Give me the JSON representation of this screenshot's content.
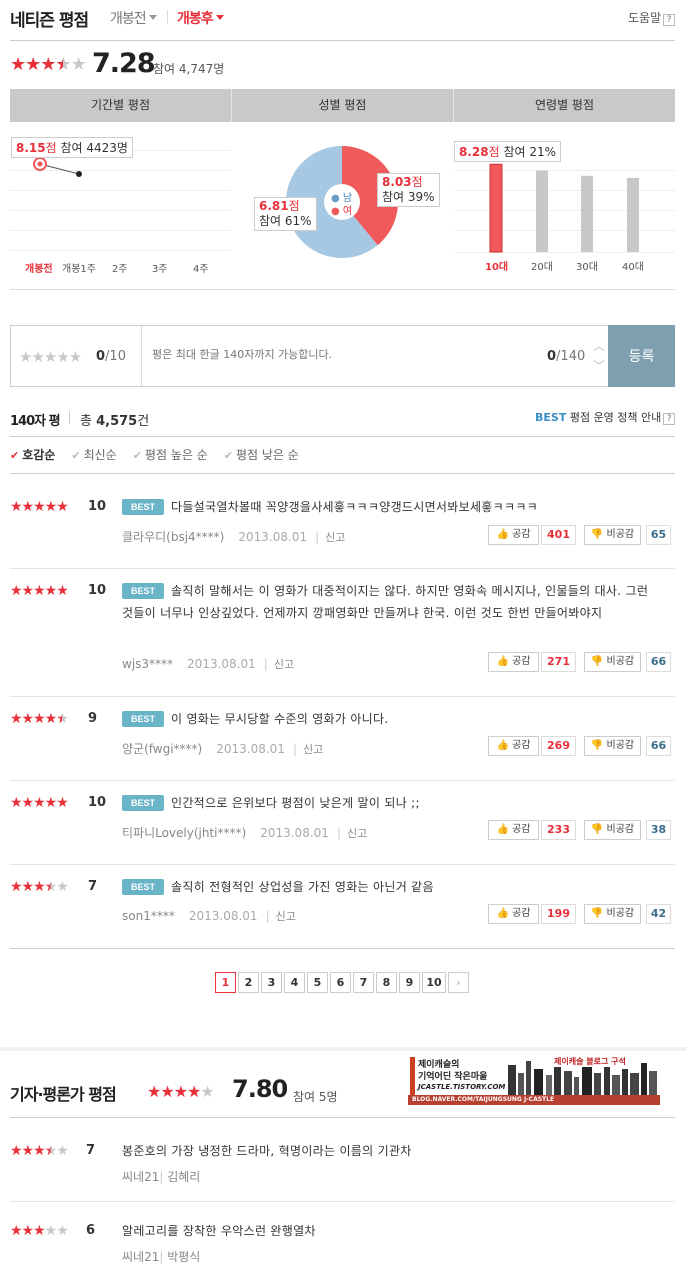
{
  "header": {
    "title": "네티즌 평점",
    "tab_before": "개봉전",
    "tab_after": "개봉후",
    "help": "도움말",
    "help_icon": "?"
  },
  "overall": {
    "score": "7.28",
    "count": "참여 4,747명",
    "stars_filled": 3.5
  },
  "chart_header": [
    "기간별 평점",
    "성별 평점",
    "연령별 평점"
  ],
  "chart_data": [
    {
      "type": "line",
      "categories": [
        "개봉전",
        "개봉1주",
        "2주",
        "3주",
        "4주"
      ],
      "values": [
        8.15,
        7.9,
        null,
        null,
        null
      ],
      "annotation": {
        "score": "8.15",
        "unit": "점",
        "count": "참여 4423명"
      }
    },
    {
      "type": "pie",
      "slices": [
        {
          "name": "남",
          "value": 61,
          "score": "6.81",
          "count": "참여 61%",
          "color": "#a6c8e2"
        },
        {
          "name": "여",
          "value": 39,
          "score": "8.03",
          "count": "참여 39%",
          "color": "#f05a5a"
        }
      ],
      "unit": "점"
    },
    {
      "type": "bar",
      "categories": [
        "10대",
        "20대",
        "30대",
        "40대"
      ],
      "values": [
        8.28,
        7.7,
        7.2,
        7.0
      ],
      "highlight": "10대",
      "annotation": {
        "score": "8.28",
        "unit": "점",
        "count": "참여 21%"
      },
      "colors": {
        "highlight": "#f05a5a",
        "normal": "#c8c8c8"
      }
    }
  ],
  "write": {
    "max_label_bold": "0",
    "max_label": "/10",
    "placeholder": "평은 최대 한글 140자까지 가능합니다.",
    "counter_bold": "0",
    "counter": "/140",
    "submit": "등록"
  },
  "reviews_header": {
    "title": "140자 평",
    "total_prefix": "총",
    "total": "4,575",
    "total_suffix": "건",
    "best_label": "BEST",
    "policy": "평점 운영 정책 안내"
  },
  "sorts": [
    "호감순",
    "최신순",
    "평점 높은 순",
    "평점 낮은 순"
  ],
  "reviews": [
    {
      "stars": 5,
      "score": "10",
      "badge": "BEST",
      "text": "다들설국열차볼때 꼭양갱을사세흫ㅋㅋㅋ양갱드시면서봐보세흫ㅋㅋㅋㅋ",
      "author": "클라우디(bsj4****)",
      "date": "2013.08.01",
      "report": "신고",
      "like_label": "공감",
      "likes": "401",
      "dislike_label": "비공감",
      "dislikes": "65"
    },
    {
      "stars": 5,
      "score": "10",
      "badge": "BEST",
      "text": "솔직히 말해서는 이 영화가 대중적이지는 않다. 하지만 영화속 메시지나, 인물들의 대사. 그런 것들이 너무나 인상깊었다. 언제까지 깡패영화만 만들꺼냐 한국. 이런 것도 한번 만들어봐야지",
      "author": "wjs3****",
      "date": "2013.08.01",
      "report": "신고",
      "like_label": "공감",
      "likes": "271",
      "dislike_label": "비공감",
      "dislikes": "66"
    },
    {
      "stars": 4.5,
      "score": "9",
      "badge": "BEST",
      "text": "이 영화는 무시당할 수준의 영화가 아니다.",
      "author": "양군(fwgi****)",
      "date": "2013.08.01",
      "report": "신고",
      "like_label": "공감",
      "likes": "269",
      "dislike_label": "비공감",
      "dislikes": "66"
    },
    {
      "stars": 5,
      "score": "10",
      "badge": "BEST",
      "text": "인간적으로 은위보다 평점이 낮은게 말이 되나 ;;",
      "author": "티파니Lovely(jhti****)",
      "date": "2013.08.01",
      "report": "신고",
      "like_label": "공감",
      "likes": "233",
      "dislike_label": "비공감",
      "dislikes": "38"
    },
    {
      "stars": 3.5,
      "score": "7",
      "badge": "BEST",
      "text": "솔직히 전형적인 상업성을 가진 영화는 아닌거 같음",
      "author": "son1****",
      "date": "2013.08.01",
      "report": "신고",
      "like_label": "공감",
      "likes": "199",
      "dislike_label": "비공감",
      "dislikes": "42"
    }
  ],
  "pager": {
    "pages": [
      "1",
      "2",
      "3",
      "4",
      "5",
      "6",
      "7",
      "8",
      "9",
      "10"
    ],
    "current": "1",
    "next": "›"
  },
  "critics": {
    "title": "기자·평론가 평점",
    "score": "7.80",
    "count": "참여 5명",
    "stars_filled": 4,
    "items": [
      {
        "stars": 3.5,
        "score": "7",
        "text": "봉준호의 가장 냉정한 드라마, 혁명이라는 이름의 기관차",
        "source": "씨네21",
        "name": "김혜리"
      },
      {
        "stars": 3,
        "score": "6",
        "text": "알레고리를 장착한 우악스런 완행열차",
        "source": "씨네21",
        "name": "박평식"
      }
    ]
  },
  "banner": {
    "line1": "제이캐슬의",
    "line2": "기억어딘 작은마을",
    "line3": "JCASTLE.TISTORY.COM",
    "line4": "BLOG.NAVER.COM/TAIJUNGSUNG J-CASTLE",
    "side": "제이캐슬 블로그 구석"
  }
}
